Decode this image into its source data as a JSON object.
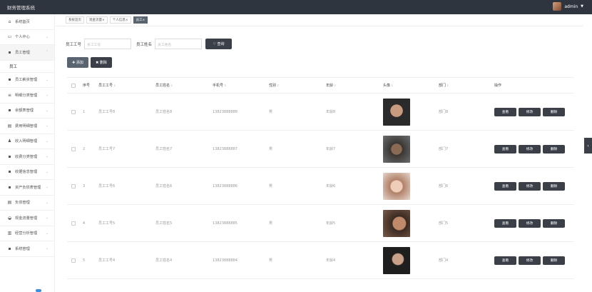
{
  "app": {
    "title": "财务管理系统",
    "user": "admin"
  },
  "sidebar": {
    "items": [
      {
        "label": "系统首页",
        "icon": "home-icon"
      },
      {
        "label": "个人中心",
        "icon": "user-card-icon"
      },
      {
        "label": "员工管理",
        "icon": "grid-icon",
        "expanded": true,
        "sub": "员工"
      },
      {
        "label": "员工薪资管理",
        "icon": "grid-icon"
      },
      {
        "label": "明细分类管理",
        "icon": "list-icon"
      },
      {
        "label": "余额表管理",
        "icon": "grid-icon"
      },
      {
        "label": "费用明细管理",
        "icon": "doc-icon"
      },
      {
        "label": "收入明细管理",
        "icon": "person-icon"
      },
      {
        "label": "收费分类管理",
        "icon": "grid-icon"
      },
      {
        "label": "收据信息管理",
        "icon": "grid-icon"
      },
      {
        "label": "资产负债表管理",
        "icon": "grid-icon"
      },
      {
        "label": "负债管理",
        "icon": "doc-icon"
      },
      {
        "label": "现金流量管理",
        "icon": "cup-icon"
      },
      {
        "label": "经营分析管理",
        "icon": "chart-icon"
      },
      {
        "label": "系统管理",
        "icon": "grid-icon"
      }
    ]
  },
  "tabs": [
    {
      "label": "系统首页",
      "active": false
    },
    {
      "label": "现金流量×",
      "active": false
    },
    {
      "label": "个人信息×",
      "active": false
    },
    {
      "label": "员工×",
      "active": true
    }
  ],
  "search": {
    "id_label": "员工工号",
    "id_placeholder": "员工工号",
    "name_label": "员工姓名",
    "name_placeholder": "员工姓名",
    "query_label": "♡ 查询"
  },
  "actions": {
    "add_label": "✚ 添加",
    "delete_label": "✖ 删除"
  },
  "table": {
    "headers": {
      "no": "序号",
      "id": "员工工号",
      "name": "员工姓名",
      "phone": "手机号",
      "sex": "性别",
      "age": "年龄",
      "head": "头像",
      "dept": "部门",
      "ops": "操作"
    },
    "ops": {
      "view": "查看",
      "edit": "修改",
      "del": "删除"
    },
    "rows": [
      {
        "no": "1",
        "id": "员工工号8",
        "name": "员工姓名8",
        "phone": "13823888888",
        "sex": "男",
        "age": "年龄8",
        "dept": "部门8"
      },
      {
        "no": "2",
        "id": "员工工号7",
        "name": "员工姓名7",
        "phone": "13823888887",
        "sex": "男",
        "age": "年龄7",
        "dept": "部门7"
      },
      {
        "no": "3",
        "id": "员工工号6",
        "name": "员工姓名6",
        "phone": "13823888886",
        "sex": "男",
        "age": "年龄6",
        "dept": "部门6"
      },
      {
        "no": "4",
        "id": "员工工号5",
        "name": "员工姓名5",
        "phone": "13823888885",
        "sex": "男",
        "age": "年龄5",
        "dept": "部门5"
      },
      {
        "no": "5",
        "id": "员工工号4",
        "name": "员工姓名4",
        "phone": "13823888884",
        "sex": "男",
        "age": "年龄4",
        "dept": "部门4"
      }
    ]
  },
  "colors": {
    "topbar": "#2f353f",
    "button": "#3b4048",
    "accent": "#3d8fe0"
  }
}
